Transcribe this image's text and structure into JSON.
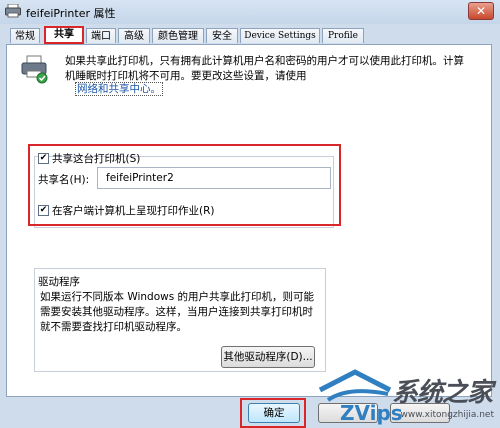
{
  "window": {
    "title": "feifeiPrinter 属性",
    "close_glyph": "✕"
  },
  "tabs": [
    {
      "label": "常规"
    },
    {
      "label": "共享",
      "active": true
    },
    {
      "label": "端口"
    },
    {
      "label": "高级"
    },
    {
      "label": "颜色管理"
    },
    {
      "label": "安全"
    },
    {
      "label": "Device Settings"
    },
    {
      "label": "Profile"
    }
  ],
  "description": "如果共享此打印机，只有拥有此计算机用户名和密码的用户才可以使用此打印机。计算机睡眠时打印机将不可用。要更改这些设置，请使用",
  "network_link": "网络和共享中心。",
  "share": {
    "share_checkbox_label": "共享这台打印机(S)",
    "share_checked": true,
    "share_name_label": "共享名(H):",
    "share_name_value": "feifeiPrinter2",
    "render_checkbox_label": "在客户端计算机上呈现打印作业(R)",
    "render_checked": true
  },
  "drivers": {
    "title": "驱动程序",
    "text": "如果运行不同版本 Windows 的用户共享此打印机，则可能需要安装其他驱动程序。这样，当用户连接到共享打印机时就不需要查找打印机驱动程序。",
    "other_drivers_button": "其他驱动程序(D)..."
  },
  "buttons": {
    "ok": "确定",
    "cancel": "",
    "apply": ""
  },
  "watermark": {
    "main": "系统之家",
    "sub": "www.xitongzhijia.net"
  },
  "colors": {
    "highlight_red": "#d8262b",
    "link_blue": "#1a55a8"
  }
}
